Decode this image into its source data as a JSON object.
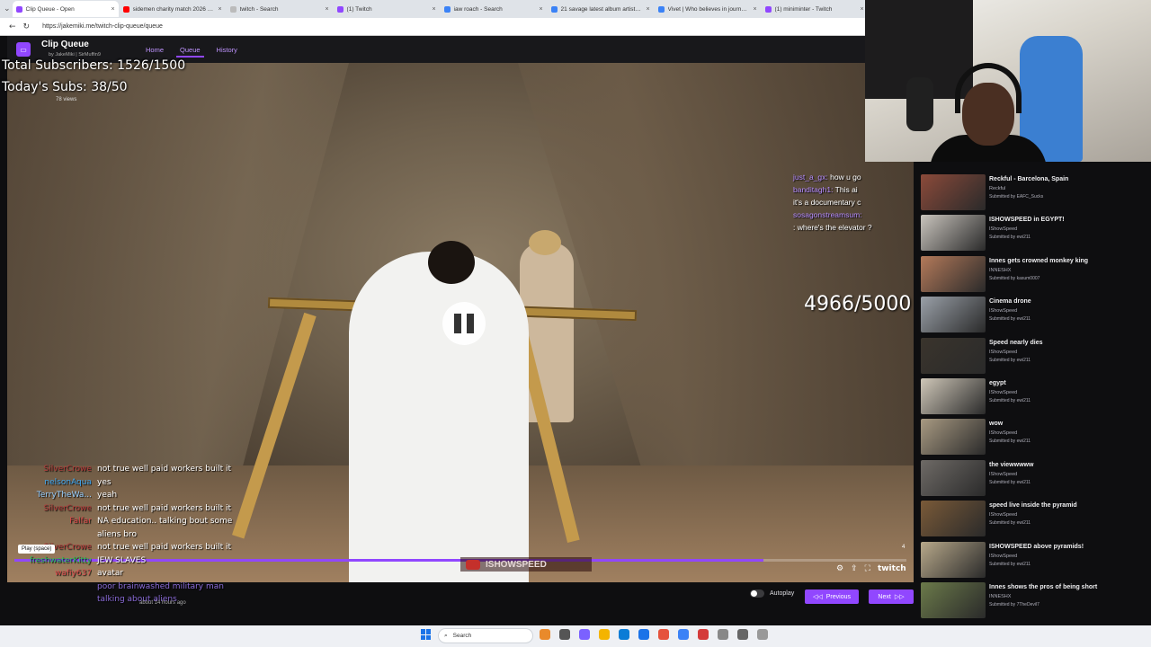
{
  "browser": {
    "tabs": [
      {
        "title": "Clip Queue - Open",
        "color": "#9147ff",
        "active": true
      },
      {
        "title": "sidemen charity match 2026 traile",
        "color": "#ff0000",
        "active": false
      },
      {
        "title": "twitch - Search",
        "color": "#bbbbbb",
        "active": false
      },
      {
        "title": "(1) Twitch",
        "color": "#9147ff",
        "active": false
      },
      {
        "title": "iaw roach - Search",
        "color": "#3b82f6",
        "active": false
      },
      {
        "title": "21 savage latest album artist - Sear",
        "color": "#3b82f6",
        "active": false
      },
      {
        "title": "Vivet | Who believes in journey - Y",
        "color": "#3b82f6",
        "active": false
      },
      {
        "title": "(1) miniminter - Twitch",
        "color": "#9147ff",
        "active": false
      }
    ],
    "url": "https://jakemiki.me/twitch-clip-queue/queue"
  },
  "app": {
    "title": "Clip Queue",
    "subtitle": "by JakeMiki | SirMuffin9",
    "nav": [
      "Home",
      "Queue",
      "History"
    ]
  },
  "overlay": {
    "total_subs": "Total Subscribers: 1526/1500",
    "today_subs": "Today's Subs: 38/50",
    "views": "78 views",
    "goal": "4966/5000"
  },
  "chat_top_right": [
    {
      "name": "just_a_gx:",
      "msg": "how u go"
    },
    {
      "name": "banditagh1:",
      "msg": "This ai"
    },
    {
      "name": "",
      "msg": "it's a documentary c"
    },
    {
      "name": "sosagonstreamsum:",
      "msg": ""
    },
    {
      "name": "",
      "msg": ": where's the elevator ?"
    }
  ],
  "chat_left": [
    {
      "name": "SilverCrowe",
      "msg": "not true well paid workers built it"
    },
    {
      "name": "nelsonAqua",
      "msg": "yes"
    },
    {
      "name": "TerryTheWa...",
      "msg": "yeah"
    },
    {
      "name": "SilverCrowe",
      "msg": "not true well paid workers built it"
    },
    {
      "name": "Falfar",
      "msg": "NA education.. talking bout some aliens bro"
    },
    {
      "name": "SilverCrowe",
      "msg": "not true well paid workers built it"
    },
    {
      "name": "freshwaterKitty",
      "msg": "JEW SLAVES"
    },
    {
      "name": "wafiy637",
      "msg": "avatar"
    },
    {
      "name": "",
      "msg": "poor brainwashed military man talking about aliens"
    }
  ],
  "chat_timestamp": "about 14 hours ago",
  "tooltip": "Play (space)",
  "player": {
    "progress_pct": 84,
    "watermark": "ISHOWSPEED",
    "clip_index": "4",
    "twitch_label": "twitch",
    "autoplay_label": "Autoplay",
    "prev_label": "Previous",
    "next_label": "Next"
  },
  "queue": [
    {
      "title": "Reckful - Barcelona, Spain",
      "channel": "Reckful",
      "by": "Submitted by EAFC_Sucks",
      "thumb": "#8b4a3a"
    },
    {
      "title": "ISHOWSPEED in EGYPT!",
      "channel": "IShowSpeed",
      "by": "Submitted by ewi211",
      "thumb": "#c9c4bd"
    },
    {
      "title": "Innes gets crowned monkey king",
      "channel": "INNESHX",
      "by": "Submitted by kasum0007",
      "thumb": "#b47a5a"
    },
    {
      "title": "Cinema drone",
      "channel": "IShowSpeed",
      "by": "Submitted by ewi211",
      "thumb": "#9aa0a8"
    },
    {
      "title": "Speed nearly dies",
      "channel": "IShowSpeed",
      "by": "Submitted by ewi211",
      "thumb": "#3a342c"
    },
    {
      "title": "egypt",
      "channel": "IShowSpeed",
      "by": "Submitted by ewi211",
      "thumb": "#cfc7b8"
    },
    {
      "title": "wow",
      "channel": "IShowSpeed",
      "by": "Submitted by ewi211",
      "thumb": "#a89a82"
    },
    {
      "title": "the viewwwww",
      "channel": "IShowSpeed",
      "by": "Submitted by ewi211",
      "thumb": "#6e6a66"
    },
    {
      "title": "speed live inside the pyramid",
      "channel": "IShowSpeed",
      "by": "Submitted by ewi211",
      "thumb": "#7a5a38"
    },
    {
      "title": "ISHOWSPEED above pyramids!",
      "channel": "IShowSpeed",
      "by": "Submitted by ewi211",
      "thumb": "#b7a88a"
    },
    {
      "title": "Innes shows the pros of being short",
      "channel": "INNESHX",
      "by": "Submitted by 7TheDevil7",
      "thumb": "#6b7a4a"
    }
  ],
  "taskbar": {
    "search_placeholder": "Search",
    "icon_colors": [
      "#e98a2b",
      "#555555",
      "#7b61ff",
      "#f4b400",
      "#0a7cd6",
      "#1a73e8",
      "#e5533d",
      "#3b82f6",
      "#d43b3b",
      "#888888",
      "#666666",
      "#999999"
    ]
  }
}
